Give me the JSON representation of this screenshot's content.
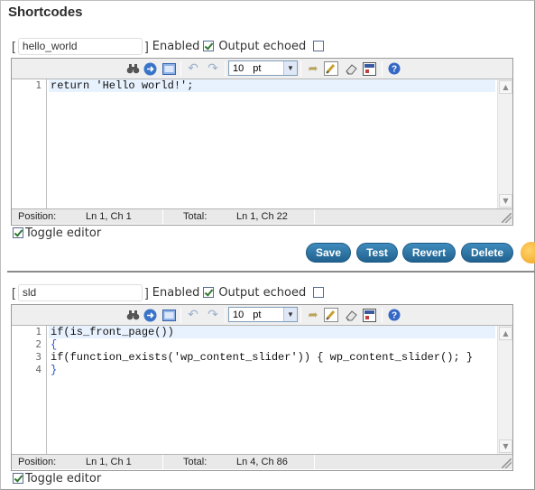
{
  "page": {
    "title": "Shortcodes"
  },
  "shortcodes": [
    {
      "bracket_open": "[",
      "name_value": "hello_world",
      "bracket_close": "]",
      "enabled_label": "Enabled",
      "enabled_checked": true,
      "output_echoed_label": "Output echoed",
      "output_echoed_checked": false,
      "font_size": "10",
      "font_unit": "pt",
      "lines": [
        {
          "num": "1",
          "code": "return 'Hello world!';"
        }
      ],
      "status": {
        "position_label": "Position:",
        "position_value": "Ln 1, Ch 1",
        "total_label": "Total:",
        "total_value": "Ln 1, Ch 22"
      },
      "toggle_label": "Toggle editor",
      "toggle_checked": true,
      "buttons": {
        "save": "Save",
        "test": "Test",
        "revert": "Revert",
        "delete": "Delete"
      }
    },
    {
      "bracket_open": "[",
      "name_value": "sld",
      "bracket_close": "]",
      "enabled_label": "Enabled",
      "enabled_checked": true,
      "output_echoed_label": "Output echoed",
      "output_echoed_checked": false,
      "font_size": "10",
      "font_unit": "pt",
      "lines": [
        {
          "num": "1",
          "code": "if(is_front_page())"
        },
        {
          "num": "2",
          "code": "{"
        },
        {
          "num": "3",
          "code": "if(function_exists('wp_content_slider')) { wp_content_slider(); }"
        },
        {
          "num": "4",
          "code": "}"
        }
      ],
      "status": {
        "position_label": "Position:",
        "position_value": "Ln 1, Ch 1",
        "total_label": "Total:",
        "total_value": "Ln 4, Ch 86"
      },
      "toggle_label": "Toggle editor",
      "toggle_checked": true
    }
  ],
  "toolbar_icons": [
    "search-icon",
    "go-to-line-icon",
    "fullscreen-icon",
    "undo-icon",
    "redo-icon",
    "font-size-select",
    "syntax-highlight-icon",
    "reset-highlight-icon",
    "eraser-icon",
    "highlight-toggle-icon",
    "help-icon"
  ]
}
